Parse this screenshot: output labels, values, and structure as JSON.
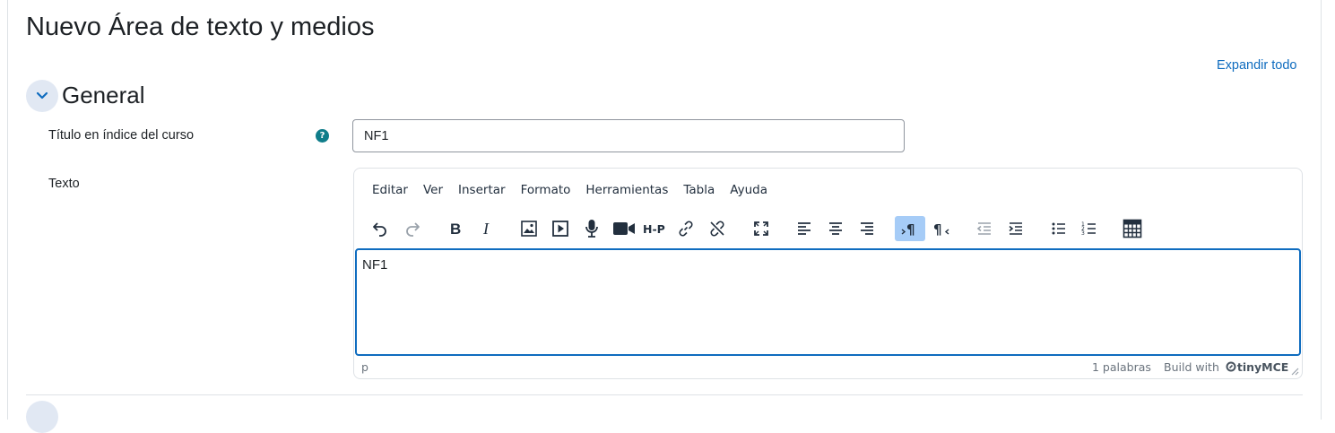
{
  "page": {
    "title": "Nuevo Área de texto y medios",
    "expand_all": "Expandir todo"
  },
  "section": {
    "title": "General",
    "toggle_icon": "chevron-down-icon"
  },
  "fields": {
    "title_label": "Título en índice del curso",
    "title_value": "NF1",
    "help_icon": "?",
    "text_label": "Texto"
  },
  "editor": {
    "menu": [
      "Editar",
      "Ver",
      "Insertar",
      "Formato",
      "Herramientas",
      "Tabla",
      "Ayuda"
    ],
    "toolbar": [
      "undo-icon",
      "redo-icon",
      "bold-icon",
      "italic-icon",
      "image-icon",
      "media-icon",
      "record-audio-icon",
      "record-video-icon",
      "h5p-icon",
      "link-icon",
      "unlink-icon",
      "fullscreen-icon",
      "align-left-icon",
      "align-center-icon",
      "align-right-icon",
      "ltr-icon",
      "rtl-icon",
      "outdent-icon",
      "indent-icon",
      "bullet-list-icon",
      "numbered-list-icon",
      "table-icon"
    ],
    "active_tool": "ltr-icon",
    "content": "NF1",
    "status_path": "p",
    "word_count": "1 palabras",
    "build_with": "Build with",
    "brand": "tinyMCE"
  },
  "colors": {
    "accent": "#0f6cbf",
    "toggle_bg": "#e1e8f3",
    "help": "#0f7d8a",
    "active_tool_bg": "#a6ccf7"
  }
}
